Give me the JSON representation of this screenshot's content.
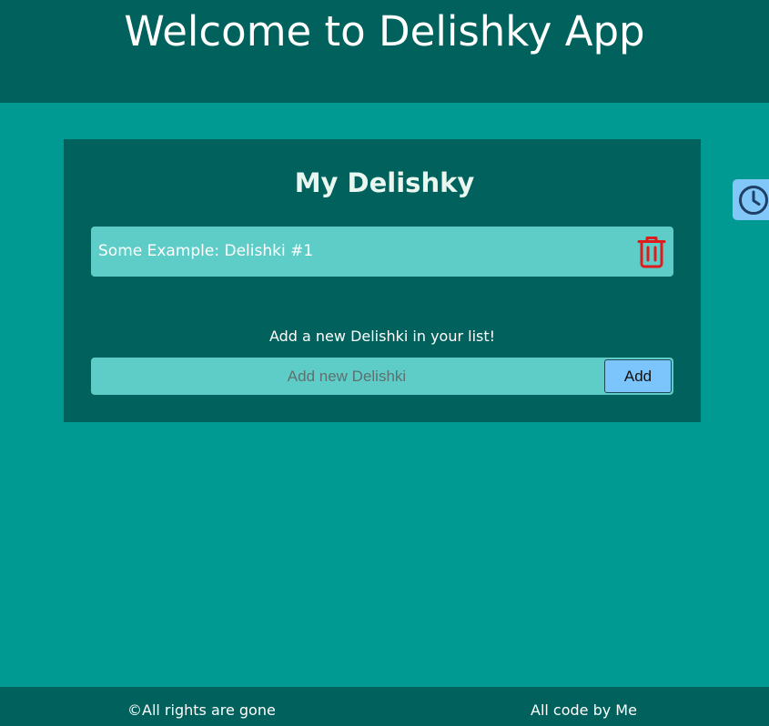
{
  "header": {
    "title": "Welcome to Delishky App"
  },
  "card": {
    "title": "My Delishky",
    "items": [
      {
        "label": "Some Example: Delishki #1",
        "delete_icon": "trash-icon"
      }
    ],
    "add_prompt": "Add a new Delishki in your list!",
    "input": {
      "value": "",
      "placeholder": "Add new Delishki"
    },
    "add_button_label": "Add"
  },
  "side_button": {
    "icon": "clock-icon"
  },
  "footer": {
    "left": "©All rights are gone",
    "right": "All code by Me"
  },
  "colors": {
    "background": "#009a93",
    "dark_teal": "#00615d",
    "light_teal": "#5ecdc7",
    "accent_blue": "#81c7f8",
    "trash_red": "#e01b1b"
  }
}
